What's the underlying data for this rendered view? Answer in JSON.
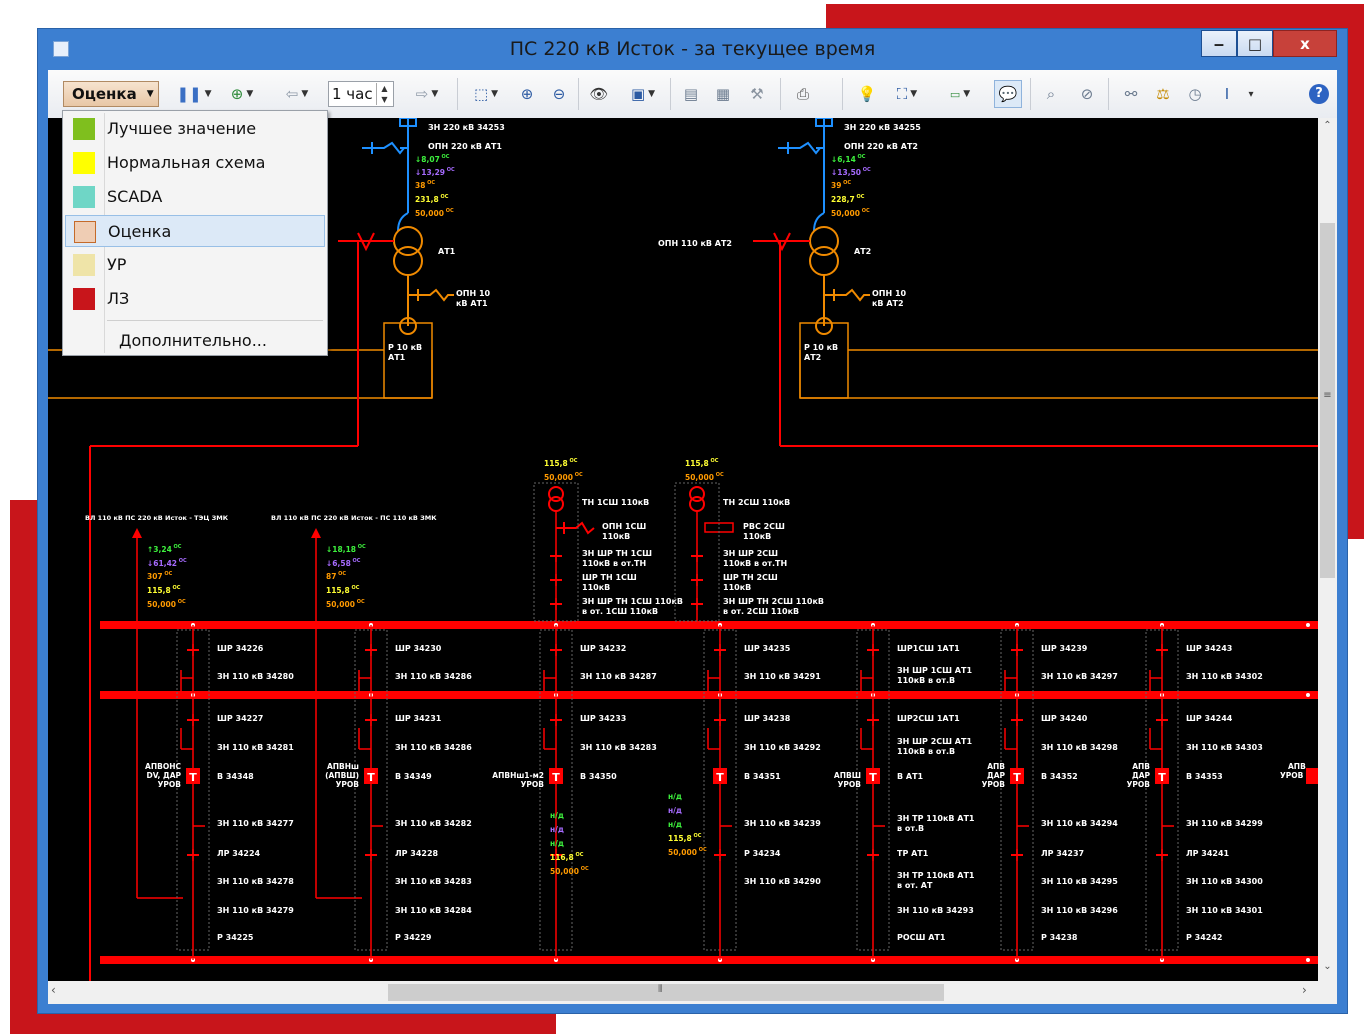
{
  "window": {
    "title": "ПС 220 кВ Исток - за текущее время",
    "minimize": "‒",
    "maximize": "□",
    "close": "x"
  },
  "toolbar": {
    "mode_label": "Оценка",
    "interval_value": "1 час"
  },
  "mode_menu": {
    "items": [
      {
        "label": "Лучшее значение",
        "color": "#7fbf1e"
      },
      {
        "label": "Нормальная схема",
        "color": "#ffff00"
      },
      {
        "label": "SCADA",
        "color": "#6fd6c6"
      },
      {
        "label": "Оценка",
        "color": "#efcdb4"
      },
      {
        "label": "УР",
        "color": "#efe4a8"
      },
      {
        "label": "ЛЗ",
        "color": "#c8151b"
      }
    ],
    "more_label": "Дополнительно..."
  },
  "colors": {
    "accent": "#c8151b",
    "window_frame": "#3c7fd1",
    "bus": "#ff0000",
    "transformer": "#f08a00",
    "equipment_220": "#1e90ff",
    "text_white": "#ffffff",
    "value_green": "#3df03d",
    "value_violet": "#a66bff",
    "value_yellow": "#ffff33",
    "value_orange": "#ff9a00"
  },
  "schema": {
    "top_left": {
      "zn": "ЗН 220 кВ 34253",
      "opn": "ОПН 220 кВ АТ1",
      "p_val": "↓8,07",
      "q_val": "↓13,29",
      "i_val": "38",
      "u_val": "231,8",
      "f_val": "50,000",
      "at": "АТ1",
      "opn10a": "ОПН 10",
      "opn10b": "кВ АТ1",
      "r10a": "Р 10 кВ",
      "r10b": "АТ1"
    },
    "top_right": {
      "zn": "ЗН 220 кВ 34255",
      "opn": "ОПН 220 кВ АТ2",
      "p_val": "↓6,14",
      "q_val": "↓13,50",
      "i_val": "39",
      "u_val": "228,7",
      "f_val": "50,000",
      "at": "АТ2",
      "opn110": "ОПН 110 кВ АТ2",
      "opn10a": "ОПН 10",
      "opn10b": "кВ АТ2",
      "r10a": "Р 10 кВ",
      "r10b": "АТ2"
    },
    "oc": "ОС",
    "tn1": {
      "u": "115,8",
      "f": "50,000",
      "name": "ТН 1СШ 110кВ",
      "opn_a": "ОПН 1СШ",
      "opn_b": "110кВ",
      "l1": "ЗН ШР ТН 1СШ",
      "l2": "110кВ в от.ТН",
      "l3": "ШР ТН 1СШ",
      "l4": "110кВ",
      "l5": "ЗН ШР ТН 1СШ 110кВ",
      "l6": "в от. 1СШ 110кВ"
    },
    "tn2": {
      "u": "115,8",
      "f": "50,000",
      "name": "ТН 2СШ 110кВ",
      "rvs_a": "РВС 2СШ",
      "rvs_b": "110кВ",
      "l1": "ЗН ШР 2СШ",
      "l2": "110кВ в от.ТН",
      "l3": "ШР ТН 2СШ",
      "l4": "110кВ",
      "l5": "ЗН ШР ТН 2СШ 110кВ",
      "l6": "в от. 2СШ 110кВ"
    },
    "vl1": {
      "name": "ВЛ 110 кВ ПС 220 кВ Исток - ТЭЦ ЗМК",
      "p": "↑3,24",
      "q": "↓61,42",
      "i": "307",
      "u": "115,8",
      "f": "50,000"
    },
    "vl2": {
      "name": "ВЛ 110 кВ ПС 220 кВ Исток - ПС 110 кВ ЗМК",
      "p": "↓18,18",
      "q": "↓6,58",
      "i": "87",
      "u": "115,8",
      "f": "50,000"
    },
    "nd_block1": {
      "a": "н/д",
      "b": "н/д",
      "c": "н/д",
      "u": "116,8",
      "f": "50,000"
    },
    "nd_block2": {
      "a": "н/д",
      "b": "н/д",
      "c": "н/д",
      "u": "115,8",
      "f": "50,000"
    },
    "t_glyph": "T",
    "bays": [
      {
        "sr1": "ШР 34226",
        "zn1": "ЗН 110 кВ 34280",
        "sr2": "ШР 34227",
        "zn2": "ЗН 110 кВ 34281",
        "apv_a": "АПВОНС",
        "apv_b": "DV, ДАР",
        "apv_c": "УРОВ",
        "v": "В 34348",
        "zn3": "ЗН 110 кВ 34277",
        "lr": "ЛР 34224",
        "zn4": "ЗН 110 кВ 34278",
        "zn5": "ЗН 110 кВ 34279",
        "r": "Р 34225"
      },
      {
        "sr1": "ШР 34230",
        "zn1": "ЗН 110 кВ 34286",
        "sr2": "ШР 34231",
        "zn2": "ЗН 110 кВ 34286",
        "apv_a": "АПВНш",
        "apv_b": "(АПВШ)",
        "apv_c": "УРОВ",
        "v": "В 34349",
        "zn3": "ЗН 110 кВ 34282",
        "lr": "ЛР 34228",
        "zn4": "ЗН 110 кВ 34283",
        "zn5": "ЗН 110 кВ 34284",
        "r": "Р 34229"
      },
      {
        "sr1": "ШР 34232",
        "zn1": "ЗН 110 кВ 34287",
        "sr2": "ШР 34233",
        "zn2": "ЗН 110 кВ 34283",
        "apv_a": "",
        "apv_b": "АПВНш1-м2",
        "apv_c": "УРОВ",
        "v": "В 34350",
        "zn3": "",
        "lr": "",
        "zn4": "",
        "zn5": "",
        "r": ""
      },
      {
        "sr1": "ШР 34235",
        "zn1": "ЗН 110 кВ 34291",
        "sr2": "ШР 34238",
        "zn2": "ЗН 110 кВ 34292",
        "apv_a": "",
        "apv_b": "",
        "apv_c": "",
        "v": "В 34351",
        "zn3": "ЗН 110 кВ 34239",
        "lr": "Р 34234",
        "zn4": "ЗН 110 кВ 34290",
        "zn5": "",
        "r": ""
      },
      {
        "sr1": "ШР1СШ 1АТ1",
        "zn1a": "ЗН ШР 1СШ АТ1",
        "zn1": "110кВ в от.В",
        "sr2": "ШР2СШ 1АТ1",
        "zn2a": "ЗН ШР 2СШ АТ1",
        "zn2": "110кВ в от.В",
        "apv_a": "",
        "apv_b": "АПВШ",
        "apv_c": "УРОВ",
        "v": "В АТ1",
        "zn3a": "ЗН ТР 110кВ АТ1",
        "zn3": "в от.В",
        "lr": "ТР АТ1",
        "zn4a": "ЗН ТР 110кВ АТ1",
        "zn4": "в от. АТ",
        "zn5": "ЗН 110 кВ 34293",
        "r": "РОСШ АТ1"
      },
      {
        "sr1": "ШР 34239",
        "zn1": "ЗН 110 кВ 34297",
        "sr2": "ШР 34240",
        "zn2": "ЗН 110 кВ 34298",
        "apv_a": "АПВ",
        "apv_b": "ДАР",
        "apv_c": "УРОВ",
        "v": "В 34352",
        "zn3": "ЗН 110 кВ 34294",
        "lr": "ЛР 34237",
        "zn4": "ЗН 110 кВ 34295",
        "zn5": "ЗН 110 кВ 34296",
        "r": "Р 34238"
      },
      {
        "sr1": "ШР 34243",
        "zn1": "ЗН 110 кВ 34302",
        "sr2": "ШР 34244",
        "zn2": "ЗН 110 кВ 34303",
        "apv_a": "АПВ",
        "apv_b": "ДАР",
        "apv_c": "УРОВ",
        "v": "В 34353",
        "zn3": "ЗН 110 кВ 34299",
        "lr": "ЛР 34241",
        "zn4": "ЗН 110 кВ 34300",
        "zn5": "ЗН 110 кВ 34301",
        "r": "Р 34242"
      }
    ],
    "edge_apv_a": "АПВ",
    "edge_apv_b": "УРОВ"
  }
}
